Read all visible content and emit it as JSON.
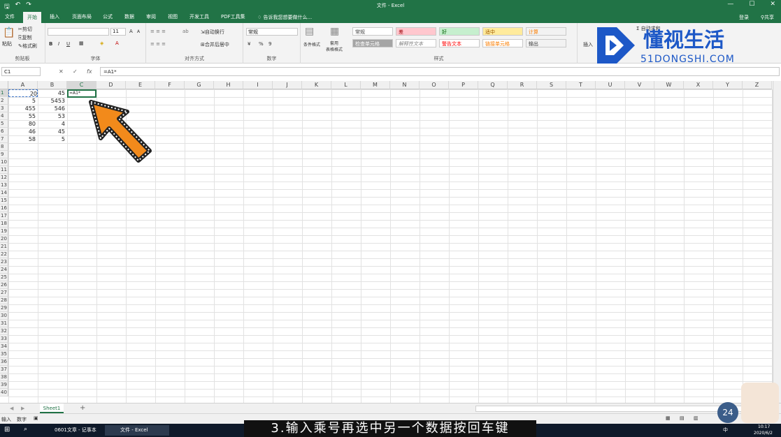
{
  "window": {
    "title": "文件 - Excel",
    "signin": "登录",
    "share": "共享",
    "min": "—",
    "max": "☐",
    "close": "✕"
  },
  "ribbon_tabs": [
    "文件",
    "开始",
    "插入",
    "页面布局",
    "公式",
    "数据",
    "审阅",
    "视图",
    "开发工具",
    "PDF工具集"
  ],
  "active_tab": "开始",
  "tell_me": "告诉我您想要做什么...",
  "ribbon": {
    "clipboard": {
      "paste": "粘贴",
      "cut": "剪切",
      "copy": "复制",
      "format_painter": "格式刷",
      "label": "剪贴板"
    },
    "font": {
      "bold": "B",
      "italic": "I",
      "underline": "U",
      "font_size": "11",
      "grow": "A",
      "shrink": "A",
      "label": "字体"
    },
    "alignment": {
      "wrap_text": "自动换行",
      "merge_center": "合并后居中",
      "label": "对齐方式"
    },
    "number": {
      "format": "常规",
      "percent": "%",
      "comma": "9",
      "label": "数字"
    },
    "styles": {
      "conditional_format": "条件格式",
      "format_as_table": "套用\n表格格式",
      "cells": [
        "常规",
        "差",
        "好",
        "适中",
        "计算",
        "检查单元格",
        "解释性文本",
        "警告文本",
        "链接单元格",
        "输出"
      ],
      "label": "样式"
    },
    "cells_group": {
      "insert": "插入",
      "autosum": "Σ 自动求和"
    }
  },
  "formula_bar": {
    "name_box": "C1",
    "cancel": "✕",
    "enter": "✓",
    "fx": "fx",
    "content": "=A1*"
  },
  "columns": [
    "A",
    "B",
    "C",
    "D",
    "E",
    "F",
    "G",
    "H",
    "I",
    "J",
    "K",
    "L",
    "M",
    "N",
    "O",
    "P",
    "Q",
    "R",
    "S",
    "T",
    "U",
    "V",
    "W",
    "X",
    "Y",
    "Z"
  ],
  "rows": [
    "1",
    "2",
    "3",
    "4",
    "5",
    "6",
    "7",
    "8",
    "9",
    "10",
    "11",
    "12",
    "13",
    "14",
    "15",
    "16",
    "17",
    "18",
    "19",
    "20",
    "21",
    "22",
    "23",
    "24",
    "25",
    "26",
    "27",
    "28",
    "29",
    "30",
    "31",
    "32",
    "33",
    "34",
    "35",
    "36",
    "37",
    "38",
    "39",
    "40"
  ],
  "cells": {
    "A": [
      "20",
      "5",
      "455",
      "55",
      "80",
      "46",
      "58"
    ],
    "B": [
      "45",
      "5453",
      "546",
      "53",
      "4",
      "45",
      "5"
    ]
  },
  "active_cell_text": "=A1*",
  "sheet_tab": "Sheet1",
  "add_sheet": "+",
  "status": {
    "mode": "输入",
    "num": "数字"
  },
  "taskbar": {
    "notepad": "0601文章 - 记事本",
    "excel": "文件 - Excel",
    "time": "10:17",
    "date": "2020/6/2",
    "ime": "中"
  },
  "caption": "3.输入乘号再选中另一个数据按回车键",
  "watermark": {
    "brand": "懂视生活",
    "domain": "51DONGSHI.COM"
  },
  "badge": "24",
  "colors": {
    "excel_green": "#217346",
    "arrow_orange": "#f28a1b",
    "logo_blue": "#1d58c7"
  }
}
